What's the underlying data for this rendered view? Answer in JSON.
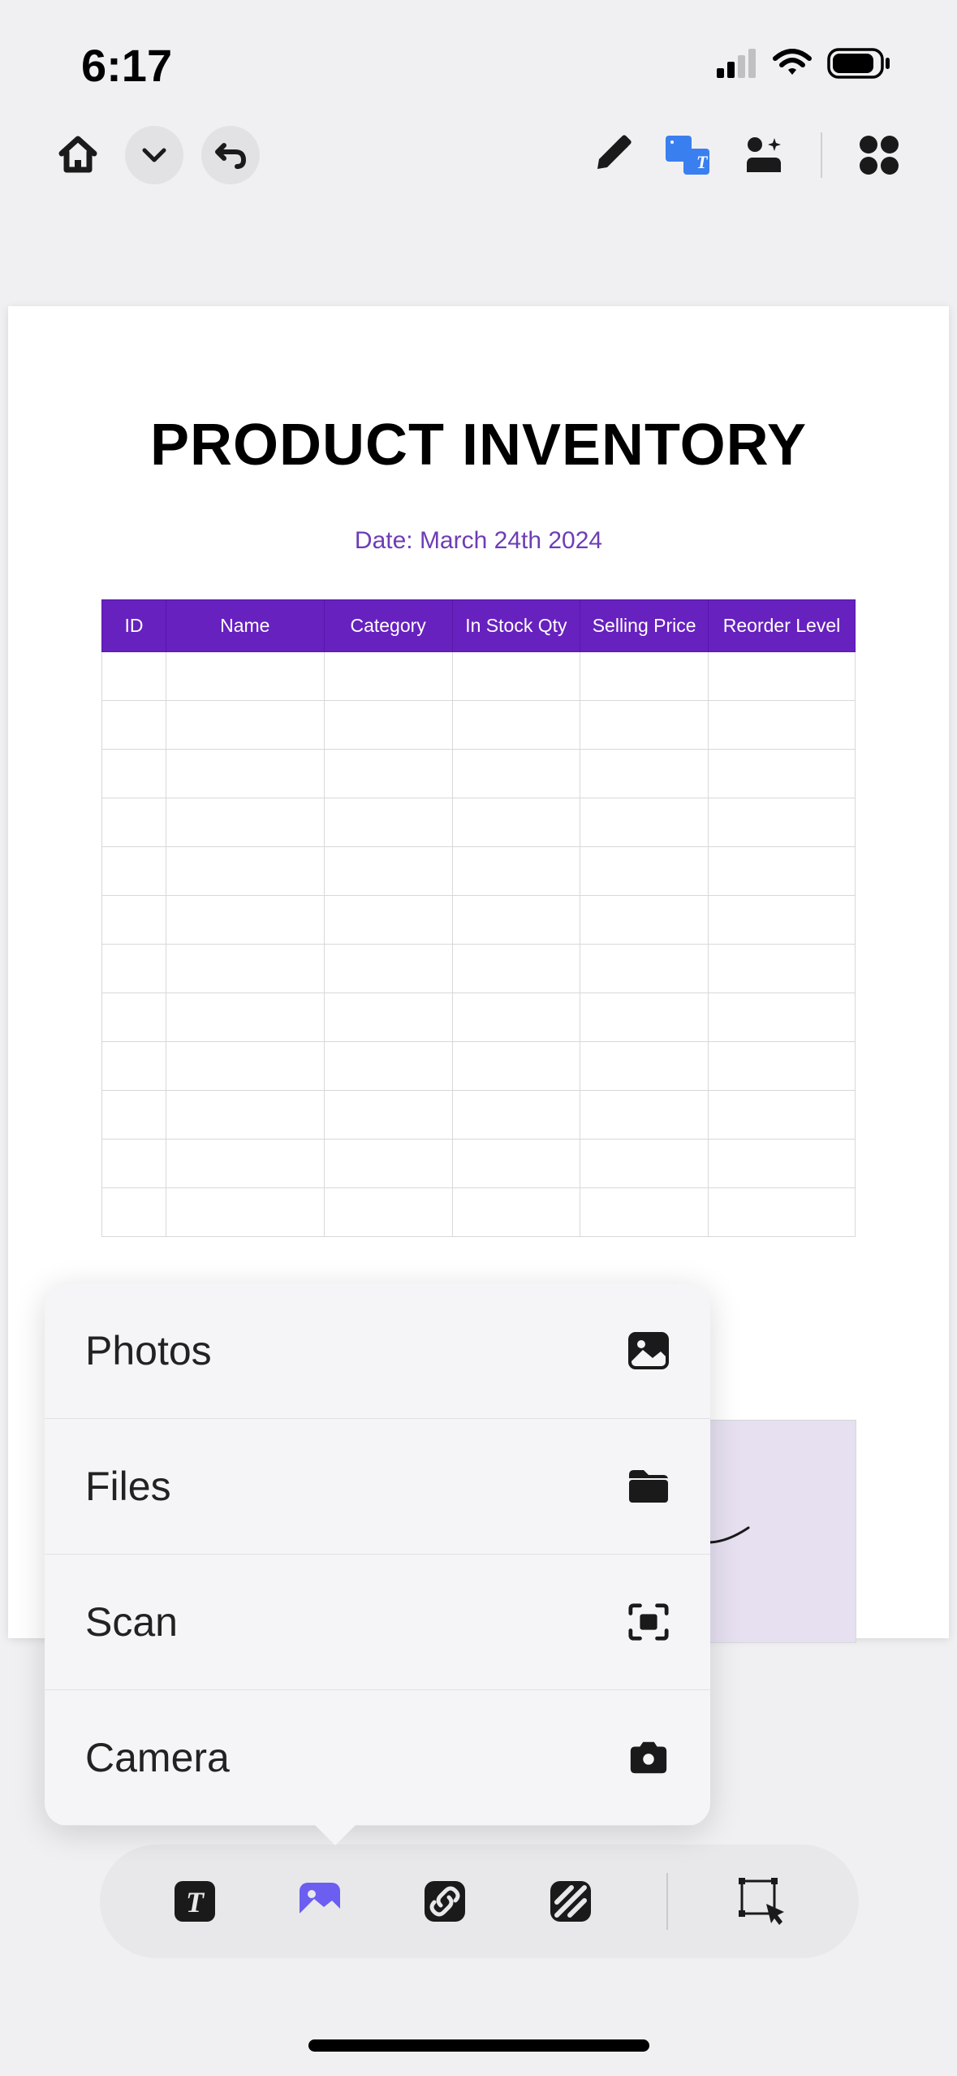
{
  "status": {
    "time": "6:17"
  },
  "document": {
    "title": "PRODUCT INVENTORY",
    "date_label": "Date: March 24th 2024",
    "columns": [
      "ID",
      "Name",
      "Category",
      "In Stock Qty",
      "Selling Price",
      "Reorder Level"
    ]
  },
  "popover": {
    "items": [
      {
        "label": "Photos",
        "icon": "photos-icon"
      },
      {
        "label": "Files",
        "icon": "folder-icon"
      },
      {
        "label": "Scan",
        "icon": "scan-icon"
      },
      {
        "label": "Camera",
        "icon": "camera-icon"
      }
    ]
  },
  "top_toolbar": {
    "home": "home-icon",
    "chevron": "chevron-down-icon",
    "undo": "undo-icon",
    "pen": "highlighter-icon",
    "translate": "text-style-icon",
    "ai": "sparkle-image-icon",
    "grid": "apps-grid-icon"
  },
  "bottom_toolbar": {
    "text": "text-tool-icon",
    "image": "image-tool-icon",
    "link": "link-tool-icon",
    "texture": "texture-tool-icon",
    "select": "select-tool-icon"
  }
}
